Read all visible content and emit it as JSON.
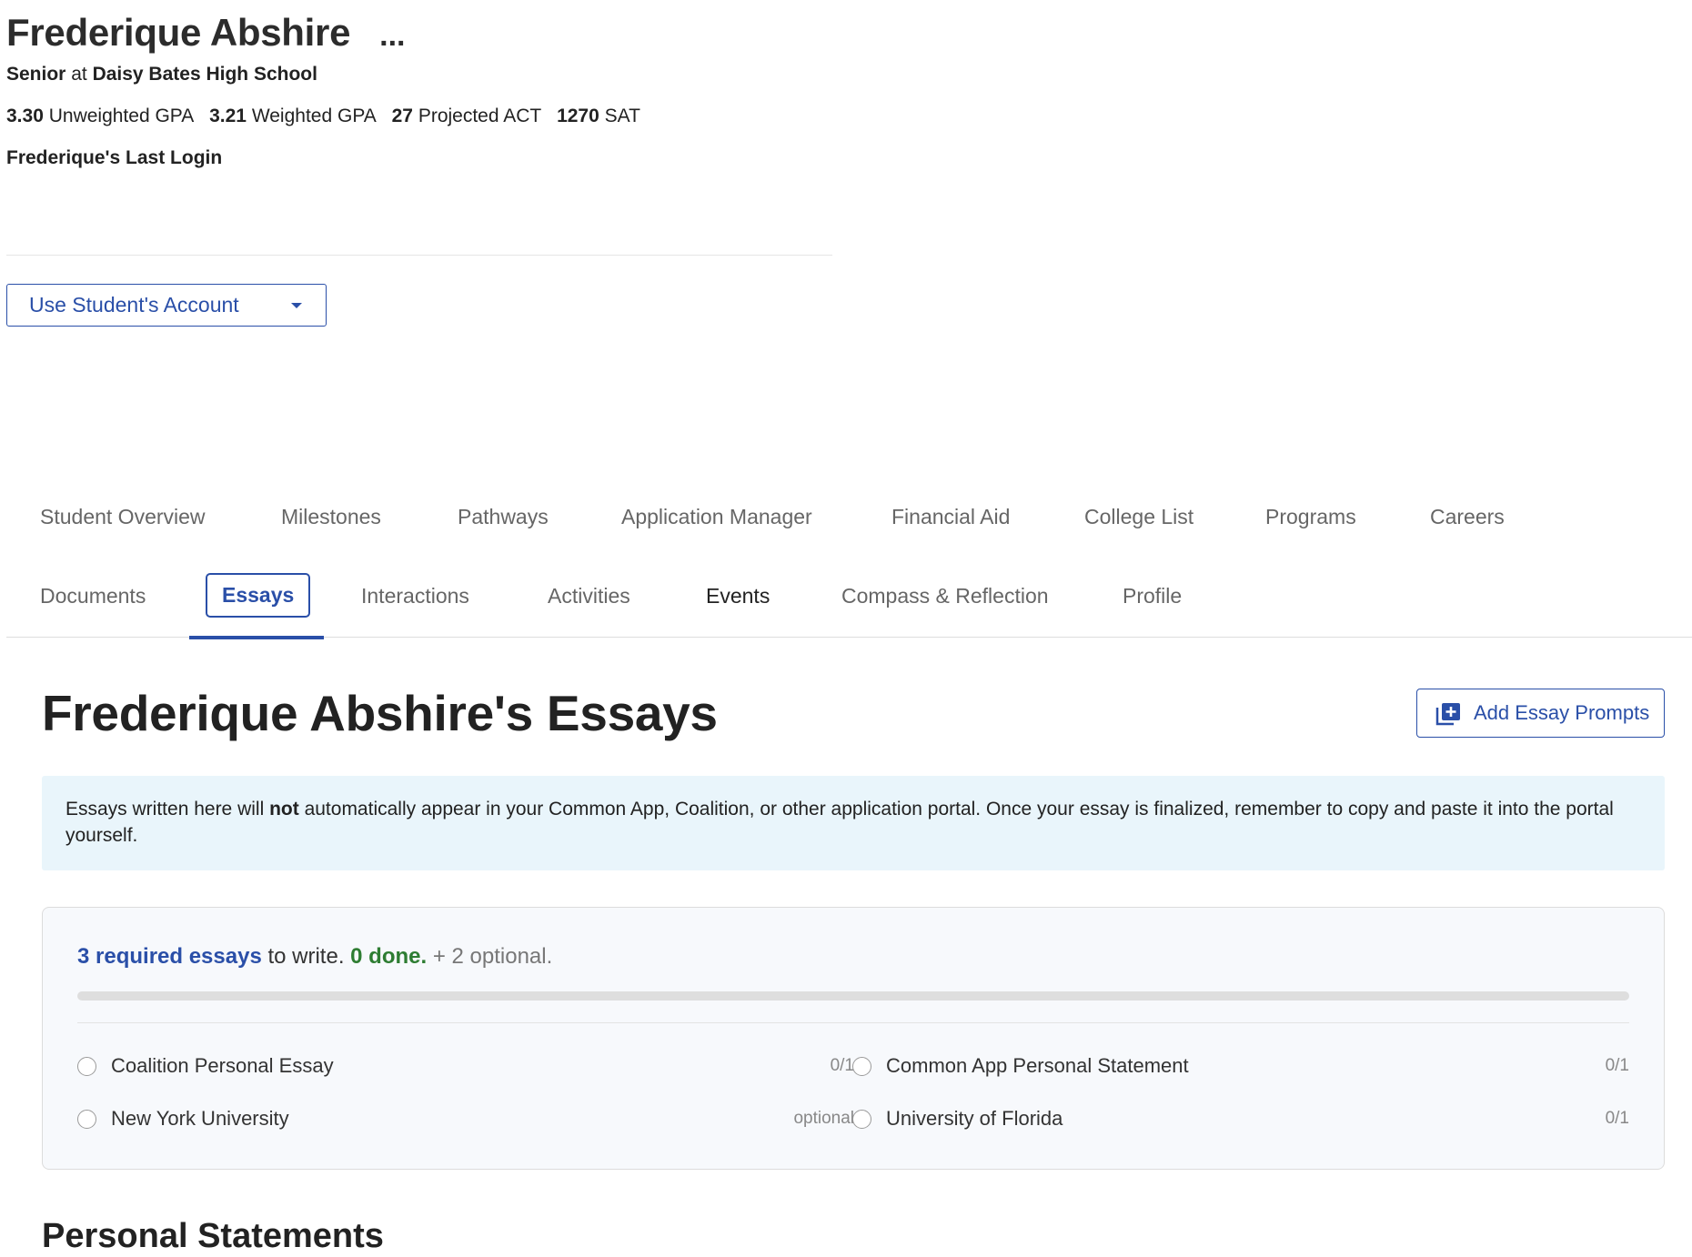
{
  "student": {
    "name": "Frederique Abshire",
    "more_label": "...",
    "grade": "Senior",
    "at_word": "at",
    "school": "Daisy Bates High School",
    "last_login_label": "Frederique's Last Login"
  },
  "stats": [
    {
      "value": "3.30",
      "label": "Unweighted GPA"
    },
    {
      "value": "3.21",
      "label": "Weighted GPA"
    },
    {
      "value": "27",
      "label": "Projected ACT"
    },
    {
      "value": "1270",
      "label": "SAT"
    }
  ],
  "account_button": {
    "label": "Use Student's Account",
    "icon": "caret-down-icon"
  },
  "tabs_row1": [
    {
      "label": "Student Overview"
    },
    {
      "label": "Milestones"
    },
    {
      "label": "Pathways"
    },
    {
      "label": "Application Manager"
    },
    {
      "label": "Financial Aid"
    },
    {
      "label": "College List"
    },
    {
      "label": "Programs"
    },
    {
      "label": "Careers"
    }
  ],
  "tabs_row2": [
    {
      "label": "Documents"
    },
    {
      "label": "Essays",
      "active": true
    },
    {
      "label": "Interactions"
    },
    {
      "label": "Activities"
    },
    {
      "label": "Events"
    },
    {
      "label": "Compass & Reflection"
    },
    {
      "label": "Profile"
    }
  ],
  "page": {
    "title": "Frederique Abshire's Essays",
    "add_button": {
      "label": "Add Essay Prompts",
      "icon": "add-to-stack-icon"
    }
  },
  "notice": {
    "before": "Essays written here will ",
    "bold": "not",
    "after": " automatically appear in your Common App, Coalition, or other application portal. Once your essay is finalized, remember to copy and paste it into the portal yourself."
  },
  "progress": {
    "required_text": "3 required essays",
    "middle_text": " to write. ",
    "done_text": "0 done.",
    "optional_text": " + 2 optional.",
    "completed_fraction": 0,
    "colors": {
      "required": "#2a4fa8",
      "done": "#2e7d32",
      "track": "#dedede"
    }
  },
  "essays": [
    {
      "label": "Coalition Personal Essay",
      "count": "0/1"
    },
    {
      "label": "Common App Personal Statement",
      "count": "0/1"
    },
    {
      "label": "New York University",
      "count": "optional"
    },
    {
      "label": "University of Florida",
      "count": "0/1"
    }
  ],
  "sections": {
    "personal_statements": "Personal Statements"
  },
  "colors": {
    "accent": "#2a4fa8",
    "notice_bg": "#e9f5fb",
    "card_bg": "#f7f9fc"
  }
}
